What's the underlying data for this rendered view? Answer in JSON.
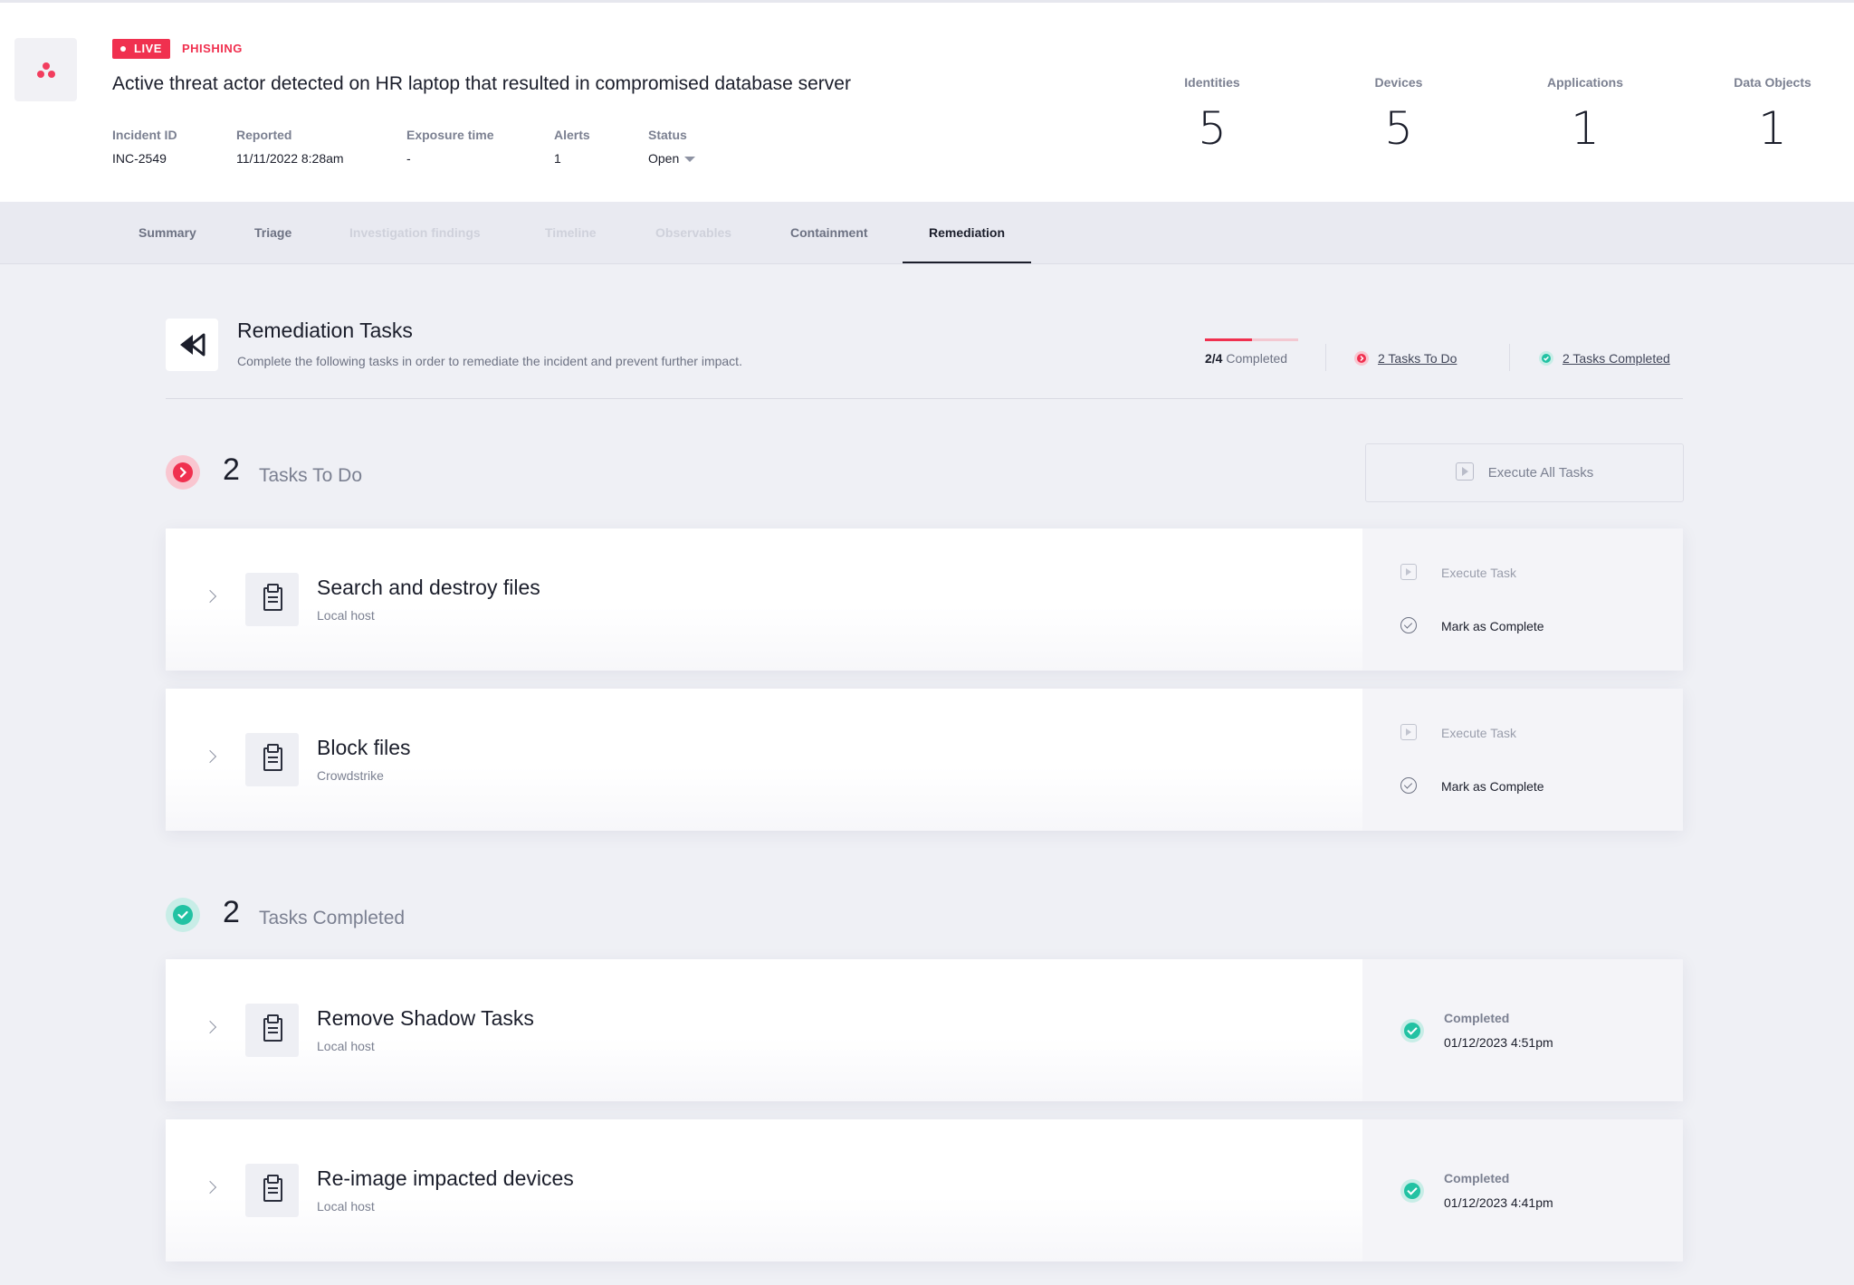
{
  "incident": {
    "live_badge": "LIVE",
    "category": "PHISHING",
    "title": "Active threat actor detected on HR laptop that resulted in compromised database server",
    "meta": [
      {
        "label": "Incident ID",
        "value": "INC-2549"
      },
      {
        "label": "Reported",
        "value": "11/11/2022 8:28am"
      },
      {
        "label": "Exposure time",
        "value": "-"
      },
      {
        "label": "Alerts",
        "value": "1"
      },
      {
        "label": "Status",
        "value": "Open"
      }
    ],
    "stats": [
      {
        "label": "Identities",
        "value": "5"
      },
      {
        "label": "Devices",
        "value": "5"
      },
      {
        "label": "Applications",
        "value": "1"
      },
      {
        "label": "Data Objects",
        "value": "1"
      }
    ]
  },
  "tabs": [
    {
      "label": "Summary",
      "state": "normal"
    },
    {
      "label": "Triage",
      "state": "normal"
    },
    {
      "label": "Investigation findings",
      "state": "disabled"
    },
    {
      "label": "Timeline",
      "state": "disabled"
    },
    {
      "label": "Observables",
      "state": "disabled"
    },
    {
      "label": "Containment",
      "state": "normal"
    },
    {
      "label": "Remediation",
      "state": "active"
    }
  ],
  "remediation": {
    "title": "Remediation Tasks",
    "subtitle": "Complete the following tasks in order to remediate the incident and prevent further impact.",
    "progress_count": "2/4",
    "progress_label": "Completed",
    "progress_fraction": 0.5,
    "todo_link": "2 Tasks To Do",
    "completed_link": "2 Tasks Completed"
  },
  "todo": {
    "count": "2",
    "label": "Tasks To Do",
    "execute_all": "Execute All Tasks",
    "tasks": [
      {
        "name": "Search and destroy files",
        "source": "Local host",
        "execute": "Execute Task",
        "mark": "Mark as Complete"
      },
      {
        "name": "Block files",
        "source": "Crowdstrike",
        "execute": "Execute Task",
        "mark": "Mark as Complete"
      }
    ]
  },
  "completed": {
    "count": "2",
    "label": "Tasks Completed",
    "tasks": [
      {
        "name": "Remove Shadow Tasks",
        "source": "Local host",
        "status": "Completed",
        "date": "01/12/2023 4:51pm"
      },
      {
        "name": "Re-image impacted devices",
        "source": "Local host",
        "status": "Completed",
        "date": "01/12/2023 4:41pm"
      }
    ]
  },
  "colors": {
    "accent_red": "#f0304f",
    "success_teal": "#22c2a3",
    "page_bg": "#eff0f5"
  }
}
